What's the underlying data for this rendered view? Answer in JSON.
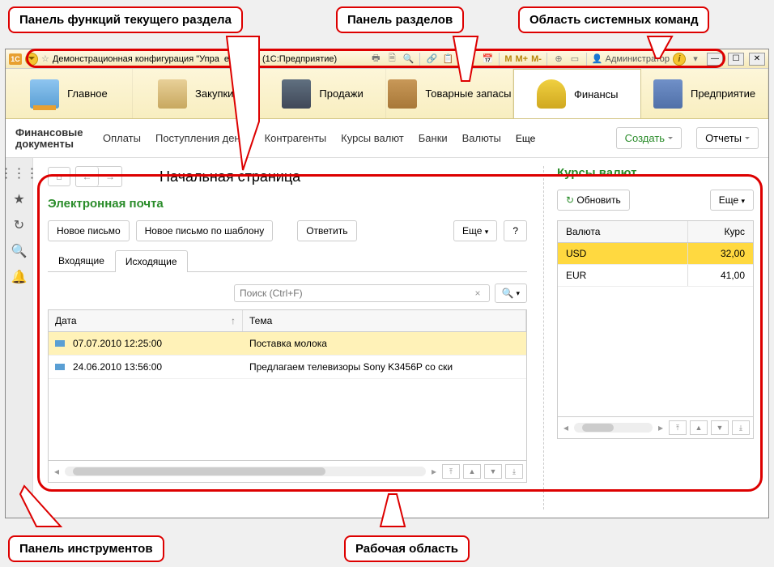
{
  "annotations": {
    "functions_panel": "Панель функций текущего раздела",
    "sections_panel": "Панель разделов",
    "system_commands": "Область системных команд",
    "tools_panel": "Панель инструментов",
    "work_area": "Рабочая область"
  },
  "titlebar": {
    "title": "Демонстрационная конфигурация \"Упра",
    "title_suffix": "емое п... (1С:Предприятие)",
    "m1": "M",
    "m2": "M+",
    "m3": "M-",
    "user": "Администратор"
  },
  "sections": {
    "main": "Главное",
    "buy": "Закупки",
    "sale": "Продажи",
    "stock": "Товарные запасы",
    "fin": "Финансы",
    "ent": "Предприятие"
  },
  "functions": {
    "main": "Финансовые документы",
    "payments": "Оплаты",
    "receipts": "Поступления денег",
    "contr": "Контрагенты",
    "rates": "Курсы валют",
    "banks": "Банки",
    "curr": "Валюты",
    "more": "Еще",
    "create": "Создать",
    "reports": "Отчеты"
  },
  "startpage": {
    "title": "Начальная страница"
  },
  "email": {
    "title": "Электронная почта",
    "new": "Новое письмо",
    "new_tpl": "Новое письмо по шаблону",
    "reply": "Ответить",
    "more": "Еще",
    "help": "?",
    "tab_in": "Входящие",
    "tab_out": "Исходящие",
    "search_ph": "Поиск (Ctrl+F)",
    "col_date": "Дата",
    "col_subj": "Тема",
    "rows": [
      {
        "date": "07.07.2010 12:25:00",
        "subj": "Поставка молока"
      },
      {
        "date": "24.06.2010 13:56:00",
        "subj": "Предлагаем телевизоры Sony K3456P со ски"
      }
    ]
  },
  "currency": {
    "title": "Курсы валют",
    "refresh": "Обновить",
    "more": "Еще",
    "col_name": "Валюта",
    "col_rate": "Курс",
    "rows": [
      {
        "name": "USD",
        "rate": "32,00"
      },
      {
        "name": "EUR",
        "rate": "41,00"
      }
    ]
  }
}
